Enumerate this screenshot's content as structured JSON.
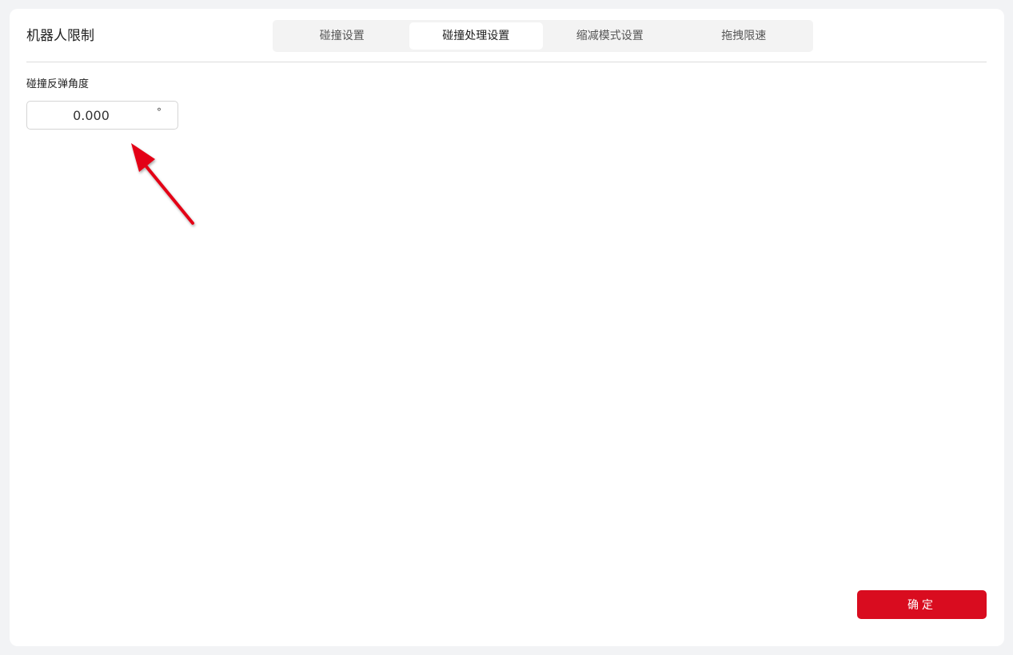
{
  "header": {
    "title": "机器人限制",
    "tabs": [
      {
        "label": "碰撞设置",
        "active": false
      },
      {
        "label": "碰撞处理设置",
        "active": true
      },
      {
        "label": "缩减模式设置",
        "active": false
      },
      {
        "label": "拖拽限速",
        "active": false
      }
    ]
  },
  "form": {
    "rebound_angle": {
      "label": "碰撞反弹角度",
      "value": "0.000",
      "unit": "°"
    }
  },
  "footer": {
    "confirm_label": "确定"
  },
  "colors": {
    "accent": "#d90c1f",
    "annotation_arrow": "#e30613",
    "background": "#f2f3f5",
    "panel": "#ffffff"
  }
}
